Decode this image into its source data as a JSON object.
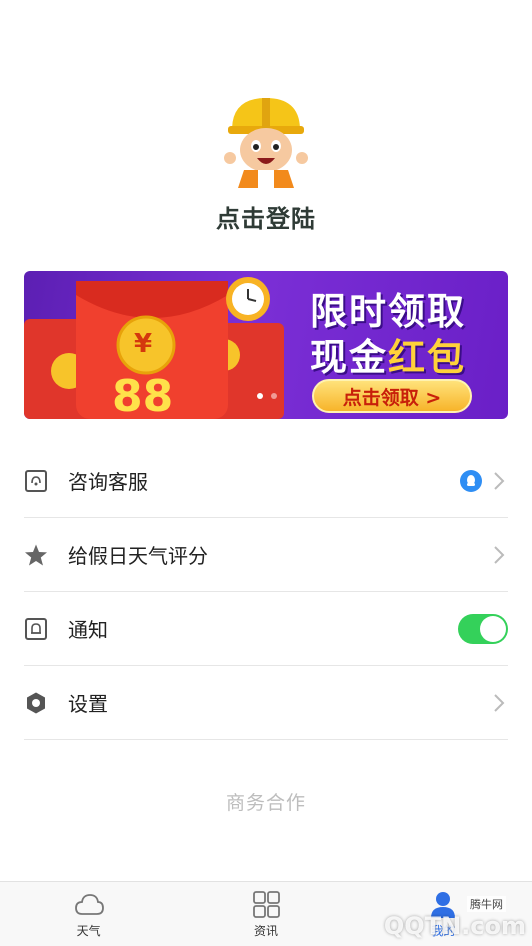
{
  "profile": {
    "login_text": "点击登陆"
  },
  "banner": {
    "title_line1": "限时领取",
    "title_line2_a": "现金",
    "title_line2_b": "红包",
    "button_label": "点击领取 >",
    "amount": "88",
    "currency_symbol": "¥",
    "slides": 2,
    "active_slide": 1
  },
  "menu": {
    "items": [
      {
        "label": "咨询客服",
        "icon": "headset-icon",
        "trailing": "qq-icon"
      },
      {
        "label": "给假日天气评分",
        "icon": "star-icon",
        "trailing": "chevron"
      },
      {
        "label": "通知",
        "icon": "bell-icon",
        "trailing": "toggle",
        "toggle_on": true
      },
      {
        "label": "设置",
        "icon": "hexagon-settings-icon",
        "trailing": "chevron"
      }
    ]
  },
  "business_link": "商务合作",
  "tabbar": {
    "tabs": [
      {
        "label": "天气",
        "icon": "cloud-icon"
      },
      {
        "label": "资讯",
        "icon": "grid-icon"
      },
      {
        "label": "我的",
        "icon": "person-icon",
        "active": true
      }
    ]
  },
  "watermark": {
    "text": "QQTN.com",
    "small_text": "腾牛网"
  },
  "colors": {
    "accent_green": "#34d15a",
    "accent_blue": "#2f6fe4",
    "banner_purple": "#6a1fc7"
  }
}
